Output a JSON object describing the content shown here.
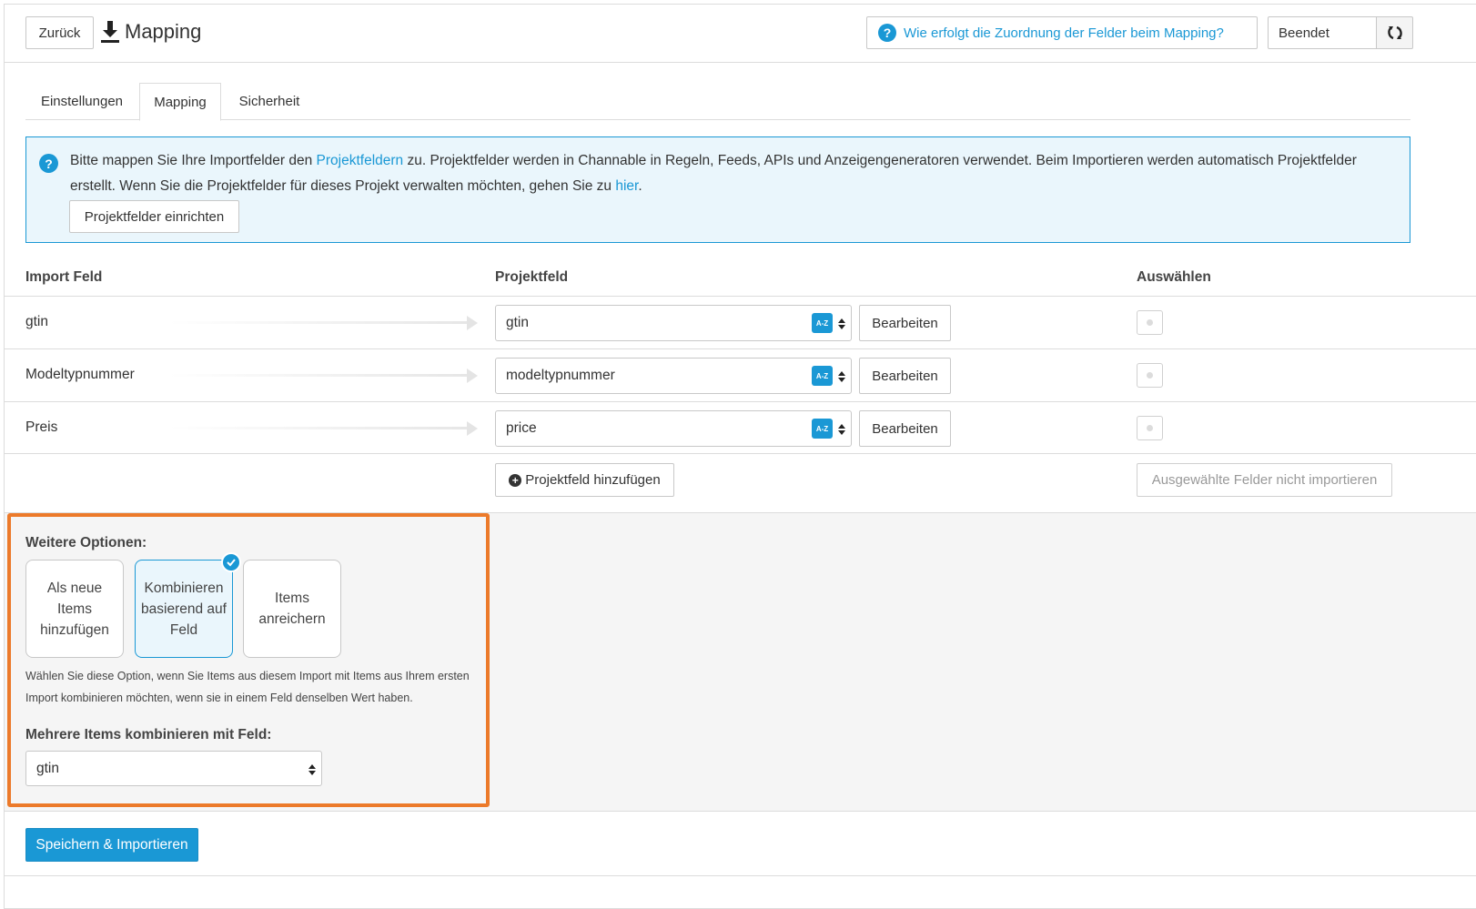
{
  "header": {
    "back_label": "Zurück",
    "title": "Mapping",
    "help_label": "Wie erfolgt die Zuordnung der Felder beim Mapping?",
    "status_value": "Beendet"
  },
  "tabs": [
    {
      "label": "Einstellungen",
      "active": false
    },
    {
      "label": "Mapping",
      "active": true
    },
    {
      "label": "Sicherheit",
      "active": false
    }
  ],
  "info": {
    "text_1": "Bitte mappen Sie Ihre Importfelder den ",
    "link_1": "Projektfeldern",
    "text_2": " zu. Projektfelder werden in Channable in Regeln, Feeds, APIs und Anzeigengeneratoren verwendet. Beim Importieren werden automatisch Projektfelder erstellt. Wenn Sie die Projektfelder für dieses Projekt verwalten möchten, gehen Sie zu ",
    "link_2": "hier",
    "text_3": ".",
    "setup_button": "Projektfelder einrichten"
  },
  "table": {
    "headers": {
      "import_field": "Import Feld",
      "project_field": "Projektfeld",
      "select": "Auswählen"
    },
    "az_label": "A-Z",
    "edit_label": "Bearbeiten",
    "rows": [
      {
        "import": "gtin",
        "project": "gtin"
      },
      {
        "import": "Modeltypnummer",
        "project": "modeltypnummer"
      },
      {
        "import": "Preis",
        "project": "price"
      }
    ],
    "add_button": "Projektfeld hinzufügen",
    "no_import_button": "Ausgewählte Felder nicht importieren"
  },
  "options": {
    "title": "Weitere Optionen:",
    "cards": [
      {
        "label": "Als neue Items hinzufügen",
        "selected": false
      },
      {
        "label": "Kombinieren basierend auf Feld",
        "selected": true
      },
      {
        "label": "Items anreichern",
        "selected": false
      }
    ],
    "description": "Wählen Sie diese Option, wenn Sie Items aus diesem Import mit Items aus Ihrem ersten Import kombinieren möchten, wenn sie in einem Feld denselben Wert haben.",
    "combine_label": "Mehrere Items kombinieren mit Feld:",
    "combine_value": "gtin"
  },
  "footer": {
    "save_label": "Speichern & Importieren"
  },
  "colors": {
    "accent": "#1a98d5",
    "highlight": "#ec7a2a",
    "info_bg": "#eaf6fc"
  }
}
